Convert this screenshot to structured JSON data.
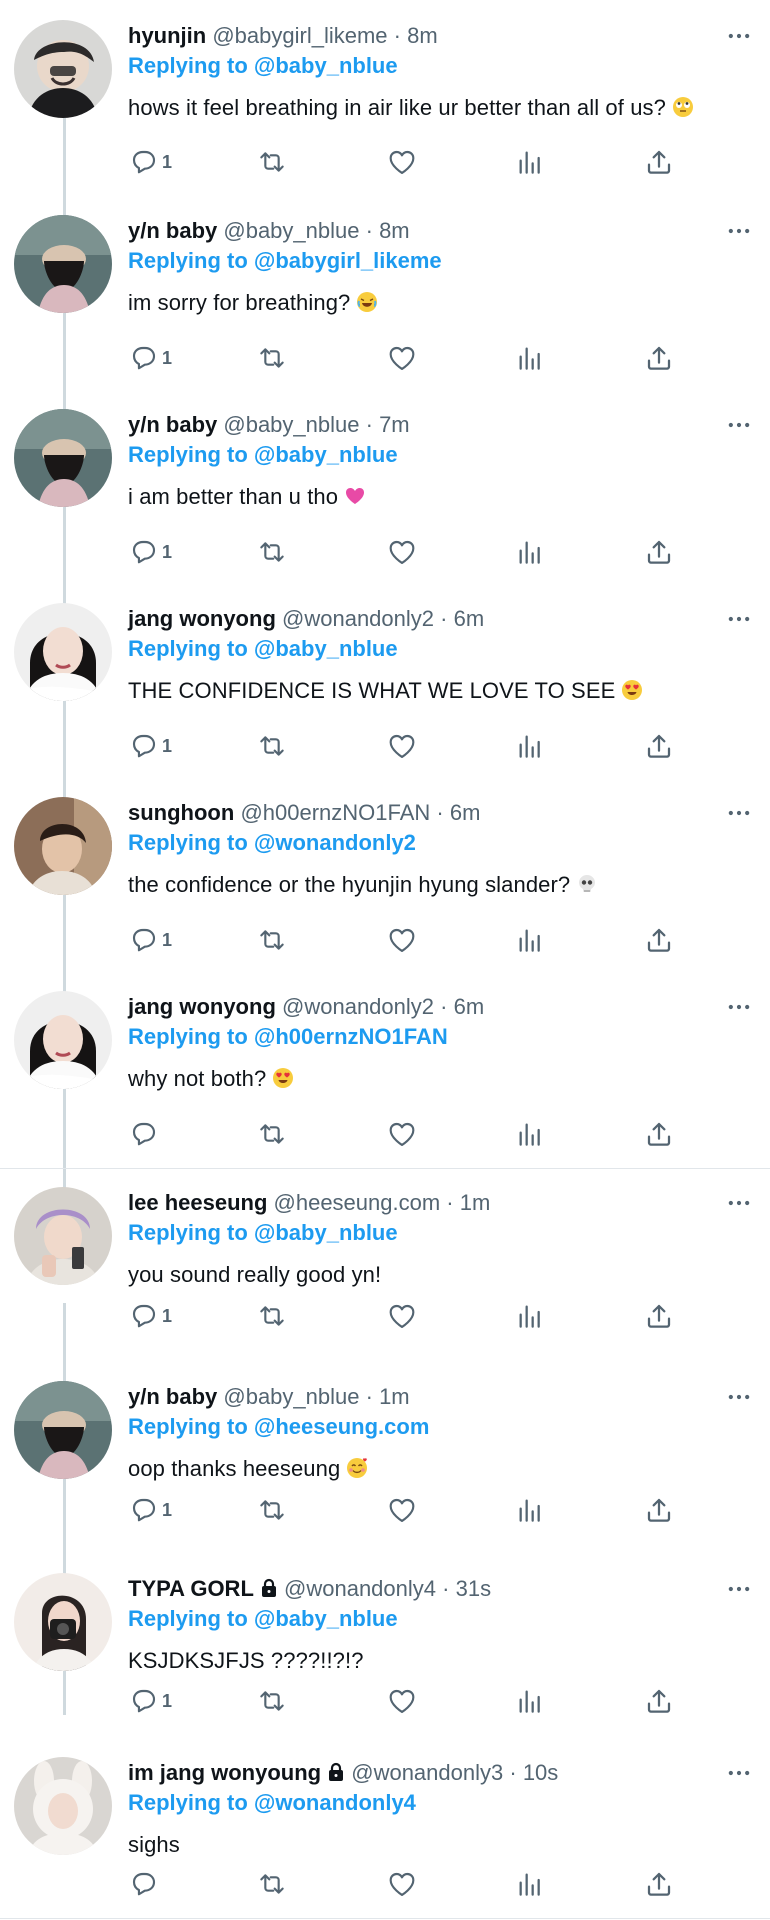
{
  "tweets": [
    {
      "name": "hyunjin",
      "handle": "@babygirl_likeme",
      "time": "8m",
      "reply_label": "Replying to",
      "reply_to": "@baby_nblue",
      "text": "hows it feel breathing in air like ur better than all of us?",
      "emoji": "rolling-eyes-emoji",
      "reply_count": "1",
      "locked": false,
      "avatar": "avatar-hyunjin"
    },
    {
      "name": "y/n baby",
      "handle": "@baby_nblue",
      "time": "8m",
      "reply_label": "Replying to",
      "reply_to": "@babygirl_likeme",
      "text": "im sorry for breathing?",
      "emoji": "crying-laughing-emoji",
      "reply_count": "1",
      "locked": false,
      "avatar": "avatar-yn-baby"
    },
    {
      "name": "y/n baby",
      "handle": "@baby_nblue",
      "time": "7m",
      "reply_label": "Replying to",
      "reply_to": "@baby_nblue",
      "text": "i am better than u tho",
      "emoji": "pink-heart-emoji",
      "reply_count": "1",
      "locked": false,
      "avatar": "avatar-yn-baby"
    },
    {
      "name": "jang wonyong",
      "handle": "@wonandonly2",
      "time": "6m",
      "reply_label": "Replying to",
      "reply_to": "@baby_nblue",
      "text": "THE CONFIDENCE IS WHAT WE LOVE TO SEE",
      "emoji": "heart-eyes-emoji",
      "reply_count": "1",
      "locked": false,
      "avatar": "avatar-wonyong"
    },
    {
      "name": "sunghoon",
      "handle": "@h00ernzNO1FAN",
      "time": "6m",
      "reply_label": "Replying to",
      "reply_to": "@wonandonly2",
      "text": "the confidence or the hyunjin hyung slander?",
      "emoji": "skull-emoji",
      "reply_count": "1",
      "locked": false,
      "avatar": "avatar-sunghoon"
    },
    {
      "name": "jang wonyong",
      "handle": "@wonandonly2",
      "time": "6m",
      "reply_label": "Replying to",
      "reply_to": "@h00ernzNO1FAN",
      "text": "why not both?",
      "emoji": "heart-eyes-emoji",
      "reply_count": "",
      "locked": false,
      "avatar": "avatar-wonyong"
    },
    {
      "name": "lee heeseung",
      "handle": "@heeseung.com",
      "time": "1m",
      "reply_label": "Replying to",
      "reply_to": "@baby_nblue",
      "text": "you sound really good yn!",
      "emoji": "",
      "reply_count": "1",
      "locked": false,
      "avatar": "avatar-heeseung"
    },
    {
      "name": "y/n baby",
      "handle": "@baby_nblue",
      "time": "1m",
      "reply_label": "Replying to",
      "reply_to": "@heeseung.com",
      "text": "oop thanks heeseung",
      "emoji": "smiling-hearts-emoji",
      "reply_count": "1",
      "locked": false,
      "avatar": "avatar-yn-baby"
    },
    {
      "name": "TYPA GORL",
      "handle": "@wonandonly4",
      "time": "31s",
      "reply_label": "Replying to",
      "reply_to": "@baby_nblue",
      "text": "KSJDKSJFJS ????!!?!?",
      "emoji": "",
      "reply_count": "1",
      "locked": true,
      "avatar": "avatar-typa-gorl"
    },
    {
      "name": "im jang wonyoung",
      "handle": "@wonandonly3",
      "time": "10s",
      "reply_label": "Replying to",
      "reply_to": "@wonandonly4",
      "text": "sighs",
      "emoji": "",
      "reply_count": "",
      "locked": true,
      "avatar": "avatar-im-jang-wonyoung"
    }
  ],
  "separator": "·",
  "colors": {
    "link": "#1d9bf0",
    "muted": "#536471",
    "text": "#0f1419",
    "thread_line": "#cfd9de",
    "divider": "#e1e6ea"
  },
  "icons": [
    "reply-icon",
    "retweet-icon",
    "like-icon",
    "views-icon",
    "share-icon",
    "more-icon"
  ]
}
